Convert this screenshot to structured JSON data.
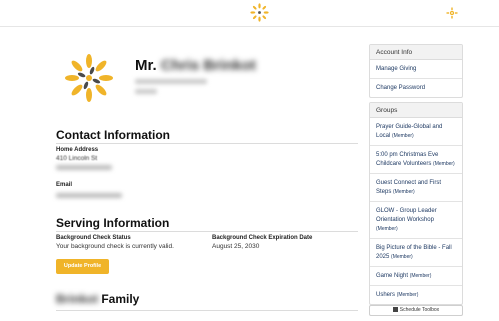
{
  "header": {
    "logo_icon": "starburst-logo",
    "settings_icon": "gear-icon",
    "accent_color": "#f0b429"
  },
  "profile": {
    "prefix": "Mr.",
    "name_blurred": "Chris Brinkot"
  },
  "contact": {
    "heading": "Contact Information",
    "home_address_label": "Home Address",
    "home_address_line1": "410 Lincoln St",
    "email_label": "Email"
  },
  "serving": {
    "heading": "Serving Information",
    "bg_check_status_label": "Background Check Status",
    "bg_check_status_value": "Your background check is currently valid.",
    "bg_check_exp_label": "Background Check Expiration Date",
    "bg_check_exp_value": "August 25, 2030",
    "update_button": "Update Profile"
  },
  "family": {
    "heading_suffix": "Family",
    "heading_blurred": "Brinkot"
  },
  "sidebar": {
    "account": {
      "title": "Account Info",
      "items": [
        {
          "label": "Manage Giving"
        },
        {
          "label": "Change Password"
        }
      ]
    },
    "groups": {
      "title": "Groups",
      "items": [
        {
          "label": "Prayer Guide-Global and Local",
          "role": "(Member)"
        },
        {
          "label": "5:00 pm Christmas Eve Childcare Volunteers",
          "role": "(Member)"
        },
        {
          "label": "Guest Connect and First Steps",
          "role": "(Member)"
        },
        {
          "label": "GLOW - Group Leader Orientation Workshop",
          "role": "(Member)"
        },
        {
          "label": "Big Picture of the Bible - Fall 2025",
          "role": "(Member)"
        },
        {
          "label": "Game Night",
          "role": "(Member)"
        },
        {
          "label": "Ushers",
          "role": "(Member)"
        }
      ]
    },
    "toolbox_button": "Schedule Toolbox"
  }
}
